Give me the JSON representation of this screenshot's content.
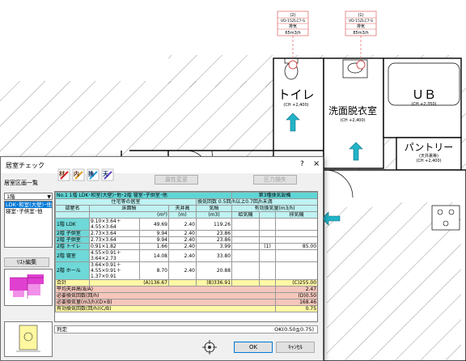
{
  "cad": {
    "vents": [
      {
        "num": "(2)",
        "model": "VD-15ZLC7-S",
        "type": "排気",
        "flow": "65m3/h"
      },
      {
        "num": "(1)",
        "model": "VD-15ZLC7-S",
        "type": "排気",
        "flow": "85m3/h"
      }
    ],
    "rooms": [
      {
        "name": "トイレ",
        "ch": "(CH +2,400)"
      },
      {
        "name": "洗面脱衣室",
        "ch": "(CH +2,400)"
      },
      {
        "name": "ＵＢ",
        "ch": "(CH +2,350)"
      },
      {
        "name": "パントリー",
        "ch": "(天井裏等)",
        "ch2": "(CH +2,400)"
      }
    ]
  },
  "dialog": {
    "title": "居室チェック",
    "help": "?",
    "close": "×",
    "room_list_label": "居室区画一覧",
    "floor_select": "1階",
    "rooms": [
      "LDK･和室(大壁)･他",
      "寝室･子供室･他"
    ],
    "list_edit_button": "ﾘｽﾄ編集",
    "toolbar_icons": [
      "材",
      "内",
      "換",
      "天"
    ],
    "attr_change_button": "属性変更",
    "pressure_loss_button": "圧力損失",
    "ok_button": "OK",
    "cancel_button": "ｷｬﾝｾﾙ",
    "judge_label": "判定",
    "judge_value": "OK(0.50≦0.75)"
  },
  "table": {
    "title": "No.1 1階 LDK･和室(大壁)･他･2階 寝室･子供室･他",
    "method": "第3種換気設備",
    "subtitle": "住宅等の居室",
    "rate_condition": "換気回数 0.5回/h以上0.7回/h未満",
    "headers": {
      "room": "部屋名",
      "floor_area": "床面積",
      "ceiling": "天井高",
      "volume": "気積",
      "effective": "有効換気量(m3/h)",
      "supply": "給気機",
      "exhaust": "排気機"
    },
    "units": {
      "floor_area": "(m²)",
      "ceiling": "(m)",
      "volume": "(m3)"
    },
    "rows": [
      {
        "room": "1階 LDK",
        "formula": "9.10×3.64＋\n4.55×3.64",
        "area": "49.69",
        "ceiling": "2.40",
        "volume": "119.26",
        "supply": "",
        "exhaust_no": "",
        "exhaust": ""
      },
      {
        "room": "2階 子供室",
        "formula": "2.73×3.64",
        "area": "9.94",
        "ceiling": "2.40",
        "volume": "23.86",
        "supply": "",
        "exhaust_no": "",
        "exhaust": ""
      },
      {
        "room": "2階 子供室",
        "formula": "2.73×3.64",
        "area": "9.94",
        "ceiling": "2.40",
        "volume": "23.86",
        "supply": "",
        "exhaust_no": "",
        "exhaust": ""
      },
      {
        "room": "2階 トイレ",
        "formula": "0.91×1.82",
        "area": "1.66",
        "ceiling": "2.40",
        "volume": "3.99",
        "supply": "",
        "exhaust_no": "(1)",
        "exhaust": "85.00"
      },
      {
        "room": "2階 寝室",
        "formula": "4.55×0.91＋\n3.64×2.73",
        "area": "14.08",
        "ceiling": "2.40",
        "volume": "33.80",
        "supply": "",
        "exhaust_no": "",
        "exhaust": ""
      },
      {
        "room": "2階 ホール",
        "formula": "3.64×0.91＋\n4.55×0.91＋\n1.37×0.91",
        "area": "8.70",
        "ceiling": "2.40",
        "volume": "20.88",
        "supply": "",
        "exhaust_no": "",
        "exhaust": ""
      }
    ],
    "total": {
      "label": "合計",
      "area": "(A)136.67",
      "volume": "(B)336.91",
      "exhaust": "(C)255.00"
    },
    "summary": [
      {
        "label": "平均天井高(B/A)",
        "value": "2.47",
        "color": "pink"
      },
      {
        "label": "必要換気回数(回/h)",
        "value": "(D)0.50",
        "color": "pink"
      },
      {
        "label": "必要換気量(m3/h)(D×B)",
        "value": "168.46",
        "color": "pink"
      },
      {
        "label": "有効換気回数(回/h)(C/B)",
        "value": "0.75",
        "color": "yel"
      }
    ]
  }
}
